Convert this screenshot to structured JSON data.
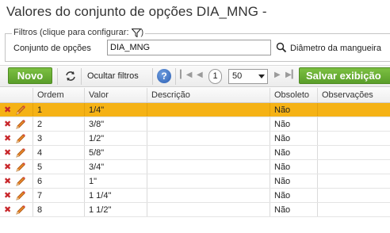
{
  "page": {
    "title": "Valores do conjunto de opções DIA_MNG -"
  },
  "filters": {
    "legend": "Filtros (clique para configurar:",
    "legend_close": ")",
    "set_label": "Conjunto de opções",
    "set_value": "DIA_MNG",
    "set_description": "Diâmetro da mangueira"
  },
  "toolbar": {
    "new_label": "Novo",
    "hide_filters_label": "Ocultar filtros",
    "help_label": "?",
    "current_page": "1",
    "page_size": "50",
    "save_view_label": "Salvar exibição"
  },
  "grid": {
    "columns": [
      "Ordem",
      "Valor",
      "Descrição",
      "Obsoleto",
      "Observações"
    ],
    "rows": [
      {
        "ordem": "1",
        "valor": "1/4\"",
        "descricao": "",
        "obsoleto": "Não",
        "observacoes": "",
        "selected": true
      },
      {
        "ordem": "2",
        "valor": "3/8\"",
        "descricao": "",
        "obsoleto": "Não",
        "observacoes": ""
      },
      {
        "ordem": "3",
        "valor": "1/2\"",
        "descricao": "",
        "obsoleto": "Não",
        "observacoes": ""
      },
      {
        "ordem": "4",
        "valor": "5/8\"",
        "descricao": "",
        "obsoleto": "Não",
        "observacoes": ""
      },
      {
        "ordem": "5",
        "valor": "3/4\"",
        "descricao": "",
        "obsoleto": "Não",
        "observacoes": ""
      },
      {
        "ordem": "6",
        "valor": "1\"",
        "descricao": "",
        "obsoleto": "Não",
        "observacoes": ""
      },
      {
        "ordem": "7",
        "valor": "1 1/4\"",
        "descricao": "",
        "obsoleto": "Não",
        "observacoes": ""
      },
      {
        "ordem": "8",
        "valor": "1 1/2\"",
        "descricao": "",
        "obsoleto": "Não",
        "observacoes": ""
      }
    ]
  },
  "icons": {
    "filter": "funnel-icon",
    "search": "magnifier-icon",
    "refresh": "refresh-arrows-icon",
    "help": "help-icon",
    "delete": "red-x-icon",
    "edit": "pencil-icon"
  },
  "colors": {
    "accent_green": "#5a9e2a",
    "selected_row": "#f5b215",
    "delete_red": "#c8262a",
    "help_blue": "#2b5fb5"
  }
}
